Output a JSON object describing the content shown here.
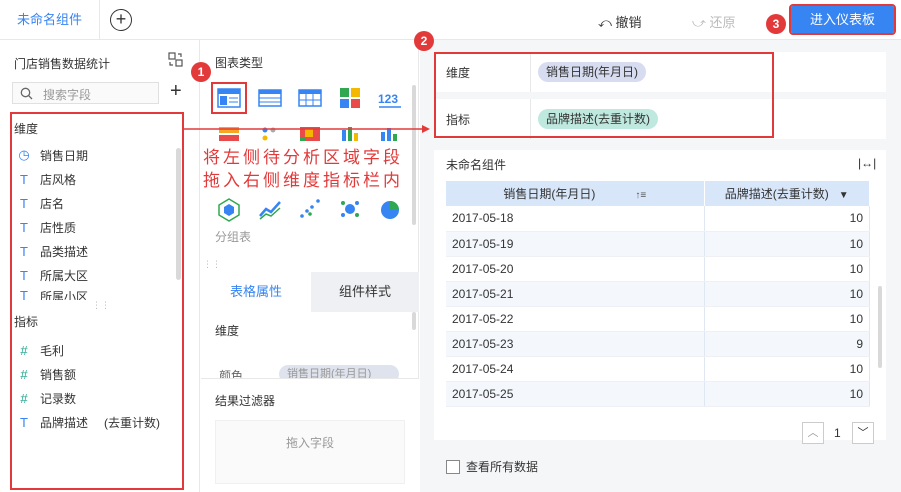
{
  "topbar": {
    "active_tab": "未命名组件",
    "add_tab": "+",
    "undo_label": "撤销",
    "redo_label": "还原",
    "enter_dashboard": "进入仪表板"
  },
  "left": {
    "dataset_title": "门店销售数据统计",
    "search_placeholder": "搜索字段",
    "add_symbol": "+",
    "dimension_title": "维度",
    "dimensions": [
      {
        "icon": "clock-icon",
        "label": "销售日期"
      },
      {
        "icon": "text-icon",
        "label": "店风格"
      },
      {
        "icon": "text-icon",
        "label": "店名"
      },
      {
        "icon": "text-icon",
        "label": "店性质"
      },
      {
        "icon": "text-icon",
        "label": "品类描述"
      },
      {
        "icon": "text-icon",
        "label": "所属大区"
      },
      {
        "icon": "text-icon",
        "label": "所属小区"
      }
    ],
    "metric_title": "指标",
    "metrics": [
      {
        "icon": "hash-icon",
        "label": "毛利"
      },
      {
        "icon": "hash-icon",
        "label": "销售额"
      },
      {
        "icon": "hash-icon",
        "label": "记录数"
      },
      {
        "icon": "text-icon",
        "label": "品牌描述",
        "suffix": "(去重计数)"
      }
    ]
  },
  "middle": {
    "chart_type_title": "图表类型",
    "group_table_label": "分组表",
    "tab_table_props": "表格属性",
    "tab_component_style": "组件样式",
    "dimension_label": "维度",
    "color_label": "颜色",
    "color_chip": "销售日期(年月日)",
    "filter_title": "结果过滤器",
    "drop_hint": "拖入字段"
  },
  "right": {
    "dim_shelf_label": "维度",
    "dim_chip": "销售日期(年月日)",
    "metric_shelf_label": "指标",
    "metric_chip": "品牌描述(去重计数)",
    "widget_title": "未命名组件",
    "expand_symbol": "|↔|",
    "table": {
      "headers": [
        "销售日期(年月日)",
        "品牌描述(去重计数)"
      ],
      "rows": [
        [
          "2017-05-18",
          "10"
        ],
        [
          "2017-05-19",
          "10"
        ],
        [
          "2017-05-20",
          "10"
        ],
        [
          "2017-05-21",
          "10"
        ],
        [
          "2017-05-22",
          "10"
        ],
        [
          "2017-05-23",
          "9"
        ],
        [
          "2017-05-24",
          "10"
        ],
        [
          "2017-05-25",
          "10"
        ]
      ]
    },
    "page_number": "1",
    "view_all_label": "查看所有数据"
  },
  "annotations": {
    "badge_1": "1",
    "badge_2": "2",
    "badge_3": "3",
    "instruction": "将左侧待分析区域字段\n拖入右侧维度指标栏内"
  },
  "colors": {
    "accent": "#3685f2",
    "annotation_red": "#e23a3a",
    "dimension_chip": "#d7dcf0",
    "metric_chip": "#bfe8df",
    "header_blue": "#d7e6f9"
  }
}
